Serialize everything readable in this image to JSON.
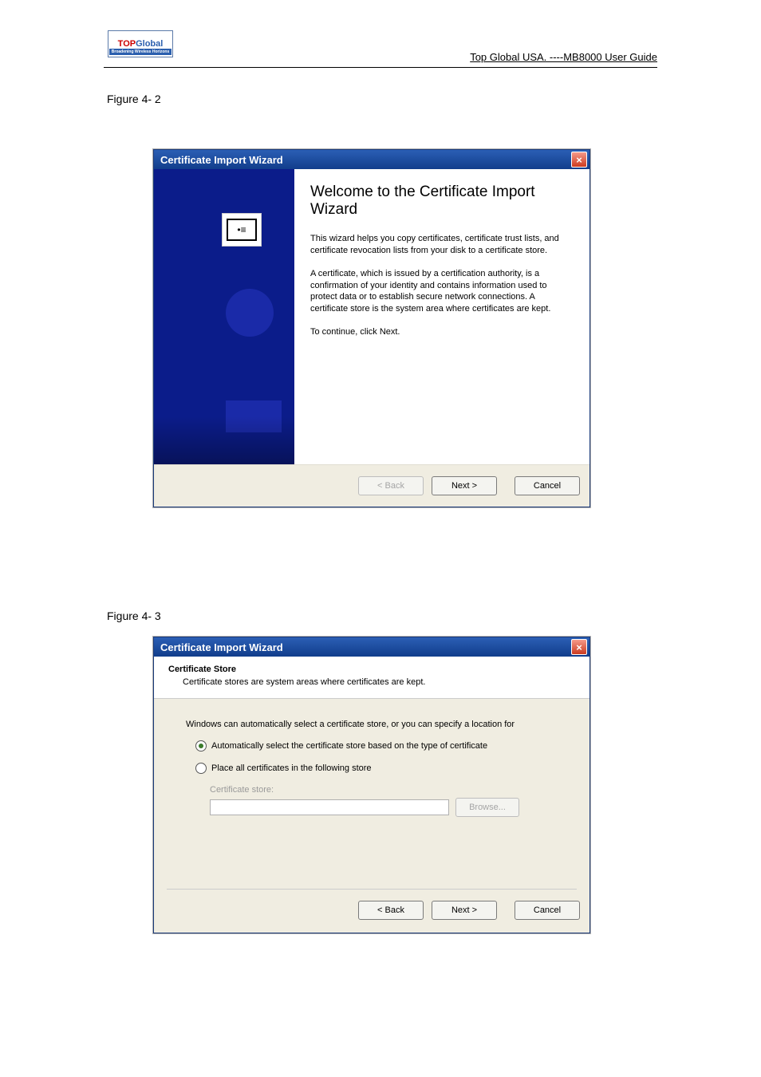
{
  "header": {
    "logo_top": "TOP",
    "logo_global": "Global",
    "logo_tag": "Broadening Wireless Horizons",
    "right_text": "Top Global USA. ----MB8000 User Guide"
  },
  "figures": {
    "fig1": "Figure 4- 2",
    "fig2": "Figure 4- 3"
  },
  "dialog1": {
    "title": "Certificate Import Wizard",
    "heading": "Welcome to the Certificate Import Wizard",
    "p1": "This wizard helps you copy certificates, certificate trust lists, and certificate revocation lists from your disk to a certificate store.",
    "p2": "A certificate, which is issued by a certification authority, is a confirmation of your identity and contains information used to protect data or to establish secure network connections. A certificate store is the system area where certificates are kept.",
    "p3": "To continue, click Next.",
    "buttons": {
      "back": "< Back",
      "next": "Next >",
      "cancel": "Cancel"
    }
  },
  "dialog2": {
    "title": "Certificate Import Wizard",
    "sub_title": "Certificate Store",
    "sub_desc": "Certificate stores are system areas where certificates are kept.",
    "intro": "Windows can automatically select a certificate store, or you can specify a location for",
    "opt1": "Automatically select the certificate store based on the type of certificate",
    "opt2": "Place all certificates in the following store",
    "store_label": "Certificate store:",
    "browse": "Browse...",
    "buttons": {
      "back": "< Back",
      "next": "Next >",
      "cancel": "Cancel"
    }
  }
}
